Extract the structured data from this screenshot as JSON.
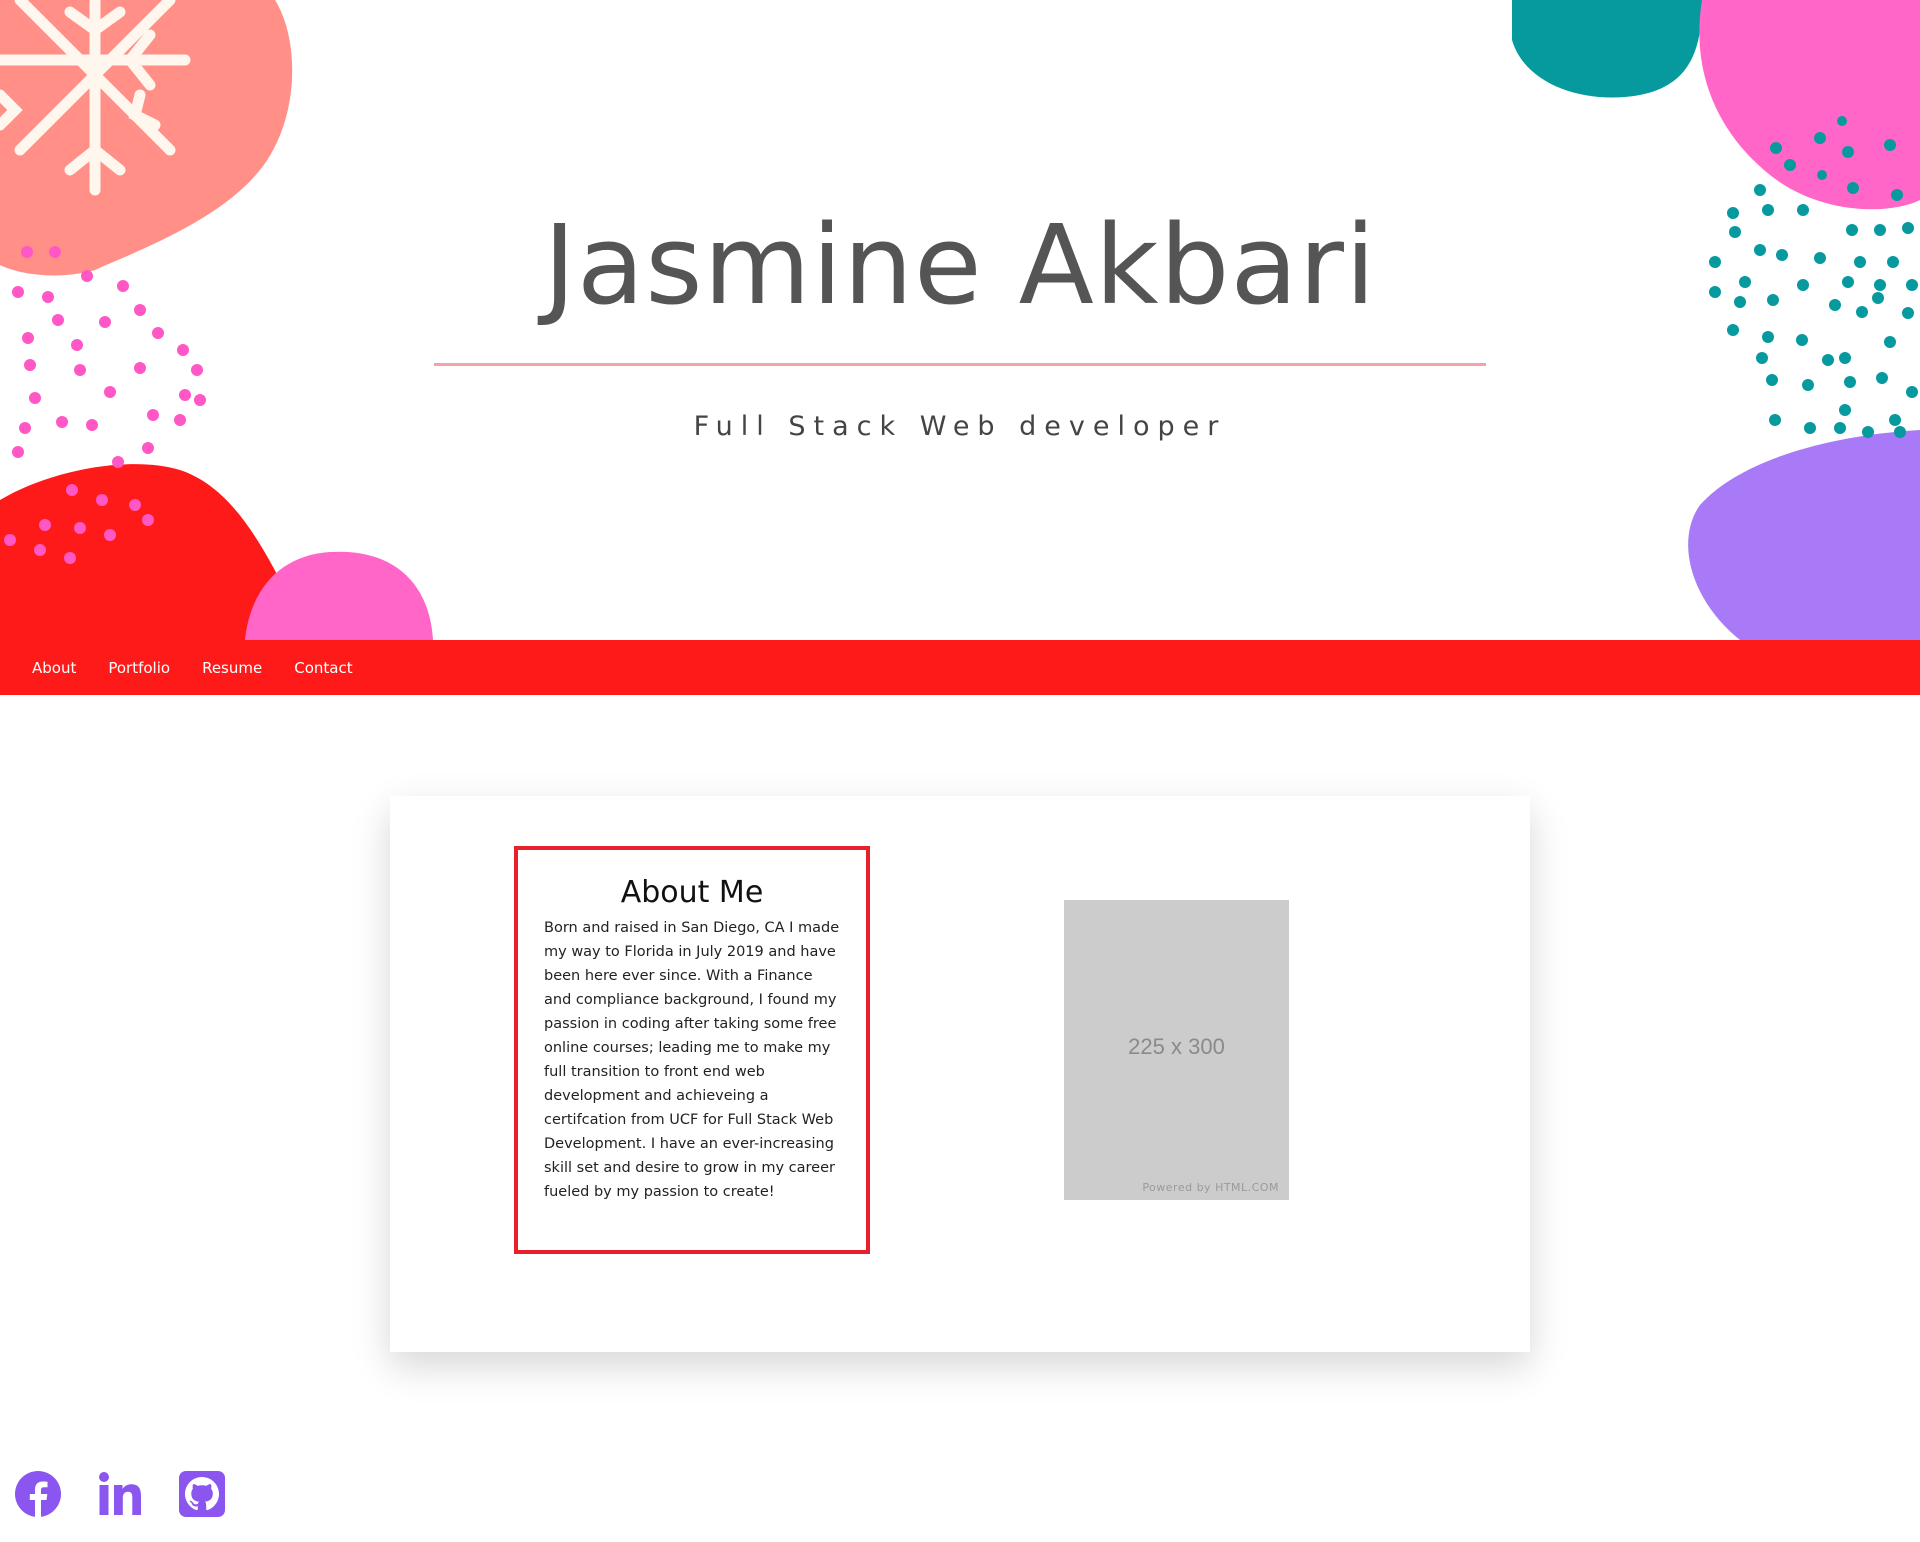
{
  "header": {
    "name": "Jasmine Akbari",
    "subtitle": "Full Stack Web developer"
  },
  "nav": {
    "items": [
      {
        "label": "About"
      },
      {
        "label": "Portfolio"
      },
      {
        "label": "Resume"
      },
      {
        "label": "Contact"
      }
    ]
  },
  "about": {
    "title": "About Me",
    "body": "Born and raised in San Diego, CA I made my way to Florida in July 2019 and have been here ever since. With a Finance and compliance background, I found my passion in coding after taking some free online courses; leading me to make my full transition to front end web development and achieveing a certifcation from UCF for Full Stack Web Development. I have an ever-increasing skill set and desire to grow in my career fueled by my passion to create!"
  },
  "profile_image": {
    "size_label": "225 x 300",
    "credit": "Powered by HTML.COM"
  },
  "social": {
    "icons": [
      "facebook-icon",
      "linkedin-icon",
      "github-icon"
    ],
    "color": "#8b55f0"
  },
  "colors": {
    "nav_bg": "#ff1a1a",
    "about_border": "#e8202a",
    "divider": "#f4a4a4",
    "salmon_blob": "#ff8f87",
    "red_blob": "#ff1a1a",
    "pink_blob": "#ff66c8",
    "teal_blob": "#069a9e",
    "purple_blob": "#a87af7"
  }
}
